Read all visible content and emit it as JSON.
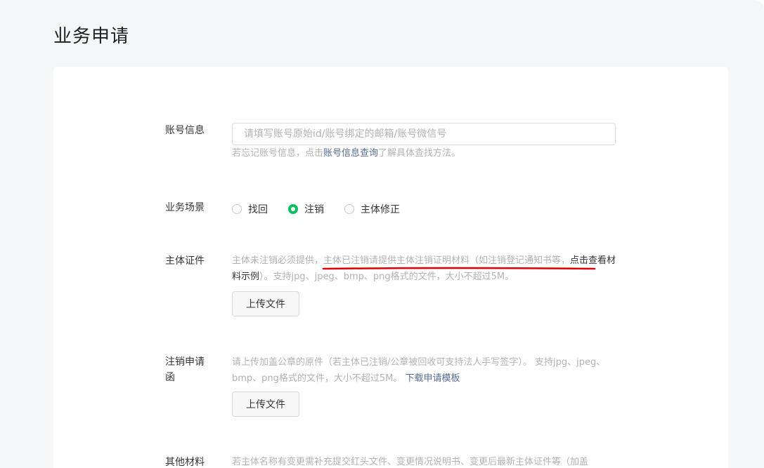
{
  "page": {
    "title": "业务申请"
  },
  "account": {
    "label": "账号信息",
    "placeholder": "请填写账号原始id/账号绑定的邮箱/账号微信号",
    "value": "",
    "hint_prefix": "若忘记账号信息，点击",
    "hint_link": "账号信息查询",
    "hint_suffix": "了解具体查找方法。"
  },
  "scenario": {
    "label": "业务场景",
    "options": [
      {
        "label": "找回",
        "checked": false
      },
      {
        "label": "注销",
        "checked": true
      },
      {
        "label": "主体修正",
        "checked": false
      }
    ]
  },
  "certificate": {
    "label": "主体证件",
    "hint_part1": "主体未注销必须提供，主体已注销请提供主体注销证明材料（如注销登记通知书等，",
    "hint_link": "点击查看材料示例",
    "hint_part2": "）。支持jpg、jpeg、bmp、png格式的文件，大小不超过5M。",
    "upload_label": "上传文件",
    "accent_color": "#e00000"
  },
  "letter": {
    "label": "注销申请函",
    "hint": "请上传加盖公章的原件（若主体已注销/公章被回收可支持法人手写签字）。 支持jpg、jpeg、bmp、png格式的文件，大小不超过5M。",
    "hint_link": "下载申请模板",
    "upload_label": "上传文件"
  },
  "other": {
    "label": "其他材料",
    "hint": "若主体名称有变更需补充提交红头文件、变更情况说明书、变更后最新主体证件等（加盖"
  }
}
